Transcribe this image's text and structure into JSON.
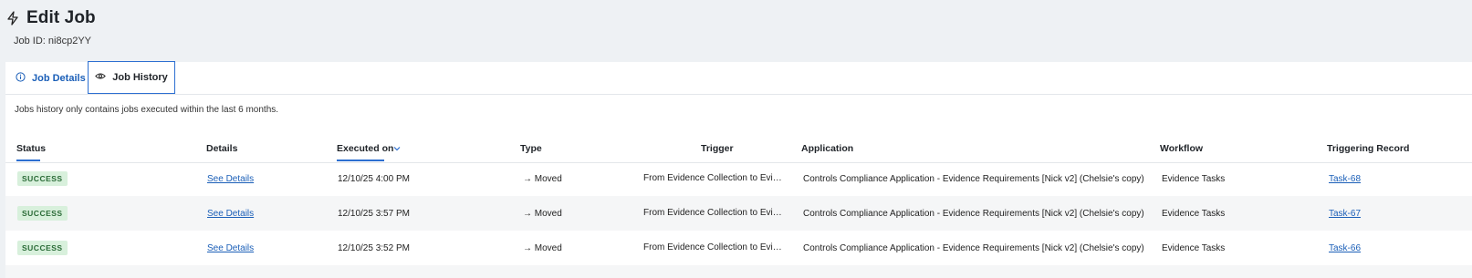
{
  "header": {
    "title": "Edit Job",
    "job_id": "Job ID: ni8cp2YY",
    "title_icon": "lightning-icon"
  },
  "tabs": [
    {
      "label": "Job Details",
      "icon": "info-icon",
      "active": false
    },
    {
      "label": "Job History",
      "icon": "eye-icon",
      "active": true
    }
  ],
  "notice": "Jobs history only contains jobs executed within the last 6 months.",
  "table": {
    "columns": [
      "Status",
      "Details",
      "Executed on",
      "Type",
      "Trigger",
      "Application",
      "Workflow",
      "Triggering Record"
    ],
    "sorted_column": "Executed on",
    "rows": [
      {
        "status": "SUCCESS",
        "details": "See Details",
        "executed_on": "12/10/25 4:00 PM",
        "type": "→ Moved",
        "trigger": "From Evidence Collection to Evidence Tasks",
        "application": "Controls Compliance Application - Evidence Requirements [Nick v2] (Chelsie's copy)",
        "workflow": "Evidence Tasks",
        "record": "Task-68"
      },
      {
        "status": "SUCCESS",
        "details": "See Details",
        "executed_on": "12/10/25 3:57 PM",
        "type": "→ Moved",
        "trigger": "From Evidence Collection to Evidence Tasks",
        "application": "Controls Compliance Application - Evidence Requirements [Nick v2] (Chelsie's copy)",
        "workflow": "Evidence Tasks",
        "record": "Task-67"
      },
      {
        "status": "SUCCESS",
        "details": "See Details",
        "executed_on": "12/10/25 3:52 PM",
        "type": "→ Moved",
        "trigger": "From Evidence Collection to Evidence Tasks",
        "application": "Controls Compliance Application - Evidence Requirements [Nick v2] (Chelsie's copy)",
        "workflow": "Evidence Tasks",
        "record": "Task-66"
      }
    ]
  },
  "colors": {
    "accent": "#2d6fd1",
    "link": "#1b5fb8",
    "success_bg": "#d8f0dc",
    "success_text": "#2a6b37",
    "page_bg": "#eef1f4"
  }
}
